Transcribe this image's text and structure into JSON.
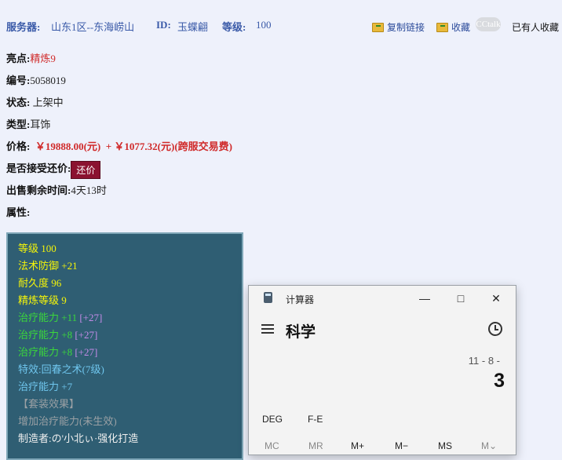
{
  "header": {
    "server_label": "服务器:",
    "server_value": "山东1区--东海崂山",
    "id_label": "ID:",
    "id_value": "玉蝶翩",
    "level_label": "等级:",
    "level_value": "100",
    "copy_link": "复制链接",
    "favorite": "收藏",
    "extra": "已有人收藏",
    "watermark": "CCtalk"
  },
  "item": {
    "highlight_label": "亮点:",
    "highlight_value": "精炼9",
    "number_label": "编号:",
    "number_value": "5058019",
    "status_label": "状态:",
    "status_value": "上架中",
    "type_label": "类型:",
    "type_value": "耳饰",
    "price_label": "价格:",
    "price_value": "￥19888.00(元)",
    "price_extra": "+ ￥1077.32(元)(跨服交易费)",
    "counter_label": "是否接受还价:",
    "counter_button": "还价",
    "time_label": "出售剩余时间:",
    "time_value": "4天13时",
    "attr_label": "属性:"
  },
  "attributes": [
    {
      "text": "等级 100",
      "color": "#f4f40a"
    },
    {
      "text": "法术防御 +21",
      "color": "#f4f40a"
    },
    {
      "text": "耐久度 96",
      "color": "#f4f40a"
    },
    {
      "text": "精炼等级 9",
      "color": "#f4f40a"
    },
    {
      "text": "治疗能力 +11",
      "extra": "[+27]",
      "color": "#3bd83b"
    },
    {
      "text": "治疗能力 +8",
      "extra": "[+27]",
      "color": "#3bd83b"
    },
    {
      "text": "治疗能力 +8",
      "extra": "[+27]",
      "color": "#3bd83b"
    },
    {
      "text": "特效:回春之术(7级)",
      "color": "#6fc6ee"
    },
    {
      "text": "治疗能力 +7",
      "color": "#6fc6ee"
    },
    {
      "text": "【套装效果】",
      "color": "#9aa0a4"
    },
    {
      "text": "增加治疗能力(未生效)",
      "color": "#9aa0a4"
    },
    {
      "text": "制造者:の'小北ぃ·强化打造",
      "color": "#f0f0f0"
    }
  ],
  "calculator": {
    "title": "计算器",
    "mode": "科学",
    "expression": "11 - 8 -",
    "result": "3",
    "deg": "DEG",
    "fe": "F-E",
    "mem": [
      "MC",
      "MR",
      "M+",
      "M−",
      "MS",
      "M⌄"
    ],
    "icons": [
      "hamburger-icon",
      "history-icon",
      "minimize-icon",
      "maximize-icon",
      "close-icon"
    ]
  }
}
